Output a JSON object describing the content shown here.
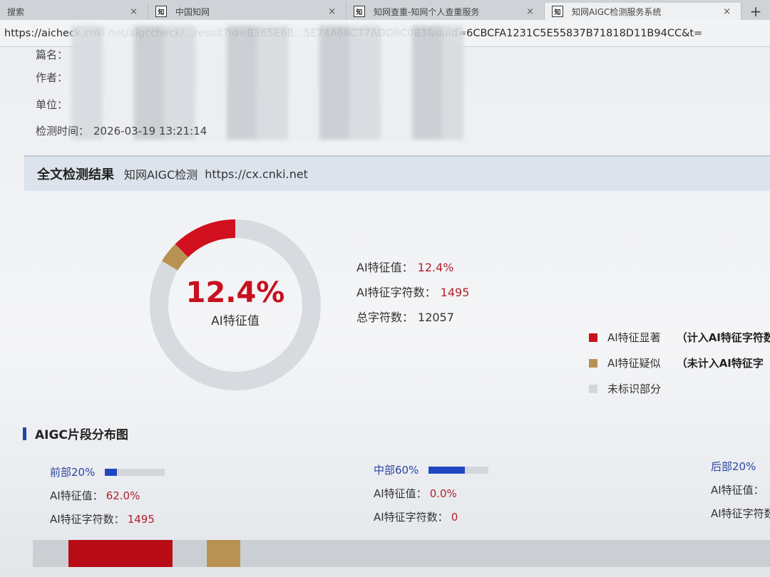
{
  "browser": {
    "tabs": [
      {
        "title": "搜索",
        "favicon": "",
        "active": false
      },
      {
        "title": "中国知网",
        "favicon": "知",
        "active": false
      },
      {
        "title": "知网查重-知网个人查重服务",
        "favicon": "知",
        "active": false
      },
      {
        "title": "知网AIGC检测服务系统",
        "favicon": "知",
        "active": true
      }
    ],
    "close_glyph": "×",
    "new_tab_glyph": "+",
    "url": "https://aicheck.cnki.net/aigccheck/...result?id=B365E6B...5E74A68C77ADD8C083&uuid=6CBCFA1231C5E55837B71818D11B94CC&t="
  },
  "meta": {
    "title_label": "篇名：",
    "author_label": "作者：",
    "unit_label": "单位：",
    "check_time_label": "检测时间：",
    "check_time": "2026-03-19 13:21:14"
  },
  "section": {
    "heading": "全文检测结果",
    "service": "知网AIGC检测",
    "site": "https://cx.cnki.net"
  },
  "donut": {
    "center_value": "12.4%",
    "center_label": "AI特征值",
    "slices": [
      {
        "name": "AI特征显著",
        "fraction": 0.124,
        "color": "#d0101e"
      },
      {
        "name": "AI特征疑似",
        "fraction": 0.04,
        "color": "#b89252"
      },
      {
        "name": "未标识部分",
        "fraction": 0.836,
        "color": "#d7dbe0"
      }
    ]
  },
  "stats": {
    "ai_value_label": "AI特征值：",
    "ai_value": "12.4%",
    "ai_chars_label": "AI特征字符数：",
    "ai_chars": "1495",
    "total_chars_label": "总字符数：",
    "total_chars": "12057"
  },
  "legend": [
    {
      "label": "AI特征显著",
      "note": "（计入AI特征字符数",
      "color": "#c8101e"
    },
    {
      "label": "AI特征疑似",
      "note": "（未计入AI特征字",
      "color": "#b89252"
    },
    {
      "label": "未标识部分",
      "note": "",
      "color": "#d3d6db"
    }
  ],
  "distribution": {
    "title": "AIGC片段分布图",
    "ai_value_label": "AI特征值：",
    "ai_chars_label": "AI特征字符数：",
    "parts": [
      {
        "name": "前部20%",
        "ai_value": "62.0%",
        "ai_chars": "1495",
        "mini_fill": 0.2
      },
      {
        "name": "中部60%",
        "ai_value": "0.0%",
        "ai_chars": "0",
        "mini_fill": 0.6
      },
      {
        "name": "后部20%",
        "ai_value": "",
        "ai_chars": "",
        "mini_fill": 0.2
      }
    ],
    "segments": [
      {
        "type": "AI特征显著",
        "color": "#b80d17"
      },
      {
        "type": "AI特征疑似",
        "color": "#b89252"
      }
    ]
  }
}
